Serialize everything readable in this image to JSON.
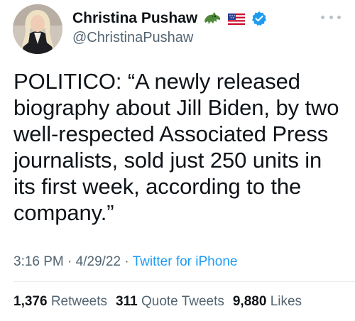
{
  "user": {
    "display_name": "Christina Pushaw",
    "handle": "@ChristinaPushaw",
    "badges": [
      "alligator-emoji",
      "us-flag-emoji",
      "verified-badge-icon"
    ]
  },
  "tweet": {
    "text": "POLITICO: “A newly released biography about Jill Biden, by two well-respected Associated Press journalists, sold just 250 units in its first week, according to the company.”",
    "time": "3:16 PM",
    "separator1": " · ",
    "date": "4/29/22",
    "separator2": " · ",
    "source": "Twitter for iPhone"
  },
  "stats": {
    "retweets_count": "1,376",
    "retweets_label": "Retweets",
    "quote_count": "311",
    "quote_label": "Quote Tweets",
    "likes_count": "9,880",
    "likes_label": "Likes"
  },
  "colors": {
    "text": "#0f1419",
    "secondary": "#536471",
    "link": "#1d9bf0",
    "verified": "#1d9bf0"
  }
}
